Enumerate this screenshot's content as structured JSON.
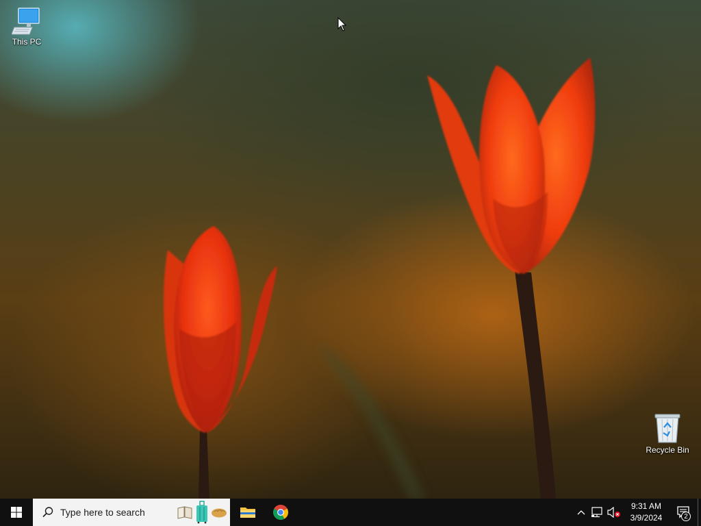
{
  "desktop": {
    "icons": [
      {
        "label": "This PC",
        "icon": "computer-icon"
      },
      {
        "label": "Recycle Bin",
        "icon": "recycle-bin-icon"
      }
    ],
    "wallpaper": "red-tulips"
  },
  "taskbar": {
    "start_icon": "windows-logo-icon",
    "search": {
      "placeholder": "Type here to search",
      "highlight_icons": [
        "book-icon",
        "suitcase-icon",
        "bread-icon"
      ]
    },
    "pinned": [
      {
        "name": "File Explorer",
        "icon": "folder-icon"
      },
      {
        "name": "Google Chrome",
        "icon": "chrome-icon"
      }
    ],
    "tray": {
      "icons": [
        "chevron-up-icon",
        "network-icon",
        "volume-muted-icon"
      ],
      "time": "9:31 AM",
      "date": "3/9/2024",
      "notification_count": "2"
    }
  },
  "colors": {
    "taskbar": "#101010",
    "search_bg": "#f3f3f3",
    "windows_blue": "#ffffff"
  }
}
